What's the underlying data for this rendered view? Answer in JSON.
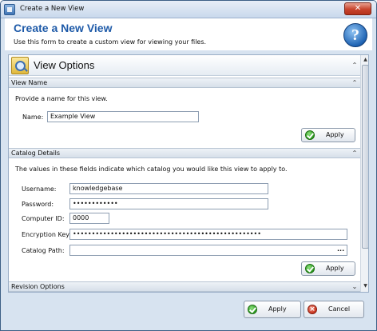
{
  "window": {
    "title": "Create a New View",
    "close_glyph": "✕"
  },
  "header": {
    "title": "Create a New View",
    "subtitle": "Use this form to create a custom view for viewing your files.",
    "help_glyph": "?"
  },
  "group": {
    "title": "View Options",
    "collapse_glyph": "⌃"
  },
  "sections": {
    "view_name": {
      "label": "View Name",
      "description": "Provide a name for this view.",
      "name_label": "Name:",
      "name_value": "Example View",
      "apply_label": "Apply"
    },
    "catalog_details": {
      "label": "Catalog Details",
      "description": "The values in these fields indicate which catalog you would like this view to apply to.",
      "username_label": "Username:",
      "username_value": "knowledgebase",
      "password_label": "Password:",
      "password_value": "••••••••••••",
      "computer_id_label": "Computer ID:",
      "computer_id_value": "0000",
      "encryption_key_label": "Encryption Key:",
      "encryption_key_value": "••••••••••••••••••••••••••••••••••••••••••••••••••",
      "catalog_path_label": "Catalog Path:",
      "catalog_path_value": "",
      "browse_glyph": "...",
      "apply_label": "Apply"
    },
    "revision_options": {
      "label": "Revision Options",
      "expand_glyph": "⌄"
    }
  },
  "footer": {
    "apply_label": "Apply",
    "cancel_label": "Cancel"
  },
  "icons": {
    "app": "app-icon",
    "help": "help-icon",
    "group": "magnifier-folder-icon",
    "ok": "check-icon",
    "cancel": "cancel-icon"
  }
}
